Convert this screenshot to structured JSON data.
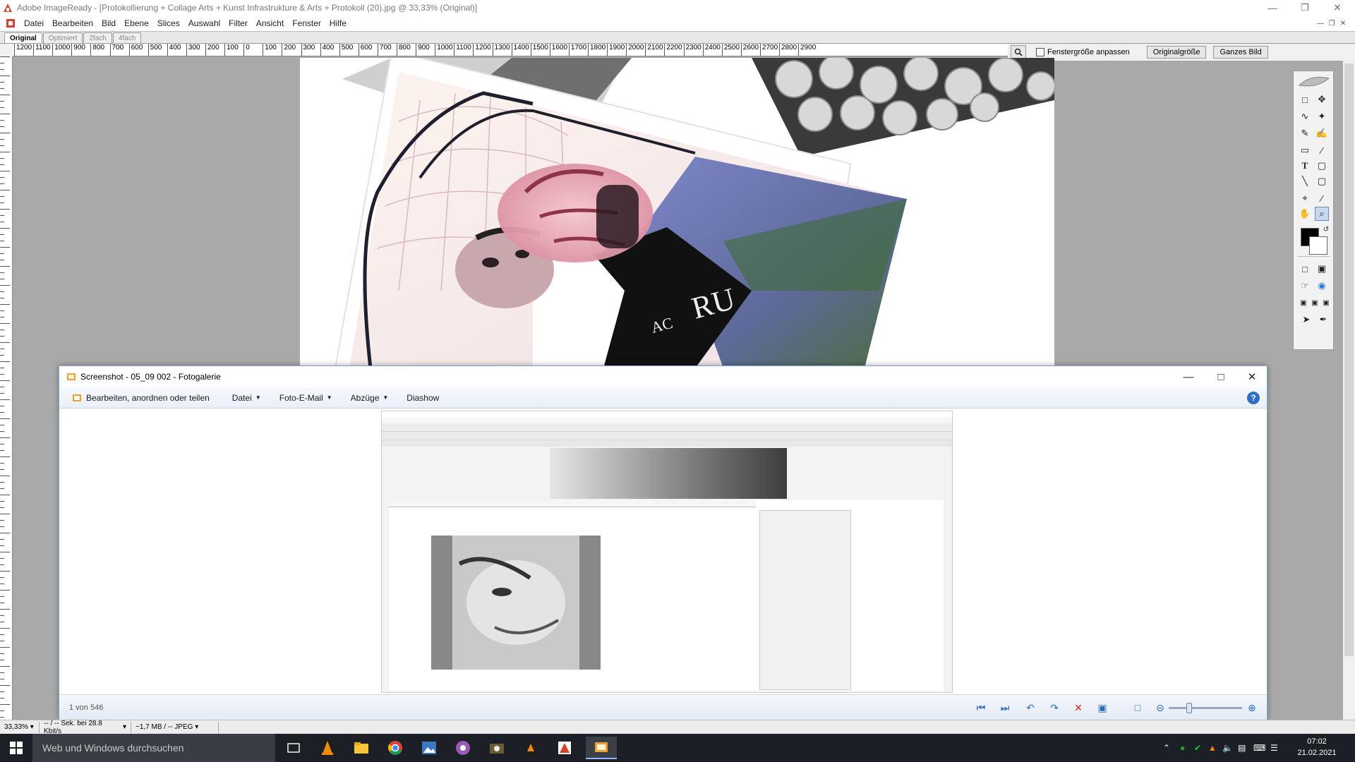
{
  "imageready": {
    "title": "Adobe ImageReady - [Protokollierung + Collage Arts + Kunst Infrastrukture & Arts + Protokoll (20).jpg @ 33,33% (Original)]",
    "menu": [
      "Datei",
      "Bearbeiten",
      "Bild",
      "Ebene",
      "Slices",
      "Auswahl",
      "Filter",
      "Ansicht",
      "Fenster",
      "Hilfe"
    ],
    "tabs": [
      "Original",
      "Optimiert",
      "2fach",
      "4fach"
    ],
    "active_tab": "Original",
    "ruler_labels": [
      "1200",
      "1100",
      "1000",
      "900",
      "800",
      "700",
      "600",
      "500",
      "400",
      "300",
      "200",
      "100",
      "0",
      "100",
      "200",
      "300",
      "400",
      "500",
      "600",
      "700",
      "800",
      "900",
      "1000",
      "1100",
      "1200",
      "1300",
      "1400",
      "1500",
      "1600",
      "1700",
      "1800",
      "1900",
      "2000",
      "2100",
      "2200",
      "2300",
      "2400",
      "2500",
      "2600",
      "2700",
      "2800",
      "2900"
    ],
    "zoombar": {
      "checkbox_label": "Fenstergröße anpassen",
      "btn_original": "Originalgröße",
      "btn_fit": "Ganzes Bild"
    },
    "status": {
      "zoom": "33,33%",
      "download": "-- / -- Sek. bei 28.8 Kbit/s",
      "size": "~1,7 MB / -- JPEG"
    }
  },
  "gallery": {
    "title": "Screenshot - 05_09 002 - Fotogalerie",
    "cmd_edit": "Bearbeiten, anordnen oder teilen",
    "cmd_file": "Datei",
    "cmd_mail": "Foto-E-Mail",
    "cmd_prints": "Abzüge",
    "cmd_slideshow": "Diashow",
    "counter": "1 von 546"
  },
  "taskbar": {
    "search_placeholder": "Web und Windows durchsuchen",
    "time": "07:02",
    "date": "21.02.2021"
  },
  "colors": {
    "canvas_gray": "#a9a9a9",
    "gallery_accent": "#2d6cc0",
    "taskbar": "#1c1f26"
  }
}
